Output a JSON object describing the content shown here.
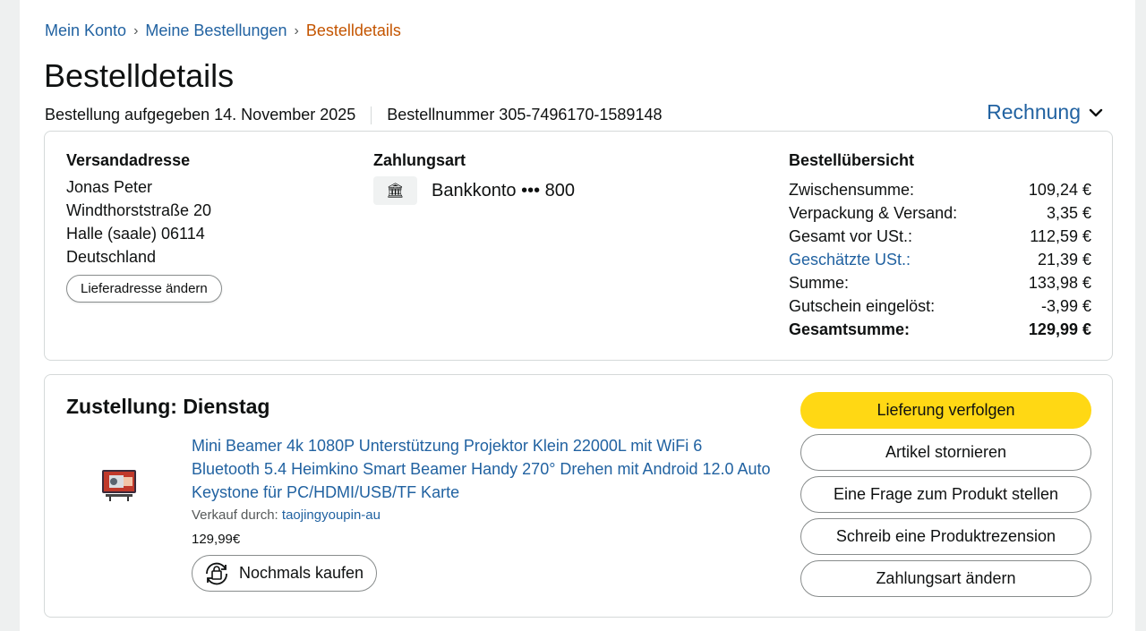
{
  "breadcrumb": {
    "items": [
      "Mein Konto",
      "Meine Bestellungen"
    ],
    "separator": "›",
    "current": "Bestelldetails"
  },
  "page": {
    "title": "Bestelldetails",
    "order_date": "Bestellung aufgegeben 14. November 2025",
    "order_number": "Bestellnummer 305-7496170-1589148",
    "invoice_label": "Rechnung"
  },
  "shipping": {
    "title": "Versandadresse",
    "lines": [
      "Jonas Peter",
      "Windthorststraße 20",
      "Halle (saale) 06114",
      "Deutschland"
    ],
    "change_button": "Lieferadresse ändern"
  },
  "payment": {
    "title": "Zahlungsart",
    "icon": "bank-icon",
    "account": "Bankkonto ••• 800"
  },
  "summary": {
    "title": "Bestellübersicht",
    "rows": [
      {
        "label": "Zwischensumme:",
        "value": "109,24 €"
      },
      {
        "label": "Verpackung & Versand:",
        "value": "3,35 €"
      },
      {
        "label": "Gesamt vor USt.:",
        "value": "112,59 €"
      },
      {
        "label": "Geschätzte USt.:",
        "value": "21,39 €"
      },
      {
        "label": "Summe:",
        "value": "133,98 €"
      },
      {
        "label": "Gutschein eingelöst:",
        "value": "-3,99 €"
      },
      {
        "label": "Gesamtsumme:",
        "value": "129,99 €"
      }
    ]
  },
  "delivery": {
    "title": "Zustellung: Dienstag",
    "product_title": "Mini Beamer 4k 1080P Unterstützung Projektor Klein 22000L mit WiFi 6 Bluetooth 5.4 Heimkino Smart Beamer Handy 270° Drehen mit Android 12.0 Auto Keystone für PC/HDMI/USB/TF Karte",
    "seller_prefix": "Verkauf durch:",
    "seller_name": "taojingyoupin-au",
    "price": "129,99€",
    "rebuy_label": "Nochmals kaufen",
    "actions": [
      "Lieferung verfolgen",
      "Artikel stornieren",
      "Eine Frage zum Produkt stellen",
      "Schreib eine Produktrezension",
      "Zahlungsart ändern"
    ]
  },
  "colors": {
    "link": "#2162a1",
    "breadcrumb_current": "#c45500",
    "primary_button": "#ffd814",
    "border": "#d5d9d9",
    "text": "#0f1111"
  }
}
